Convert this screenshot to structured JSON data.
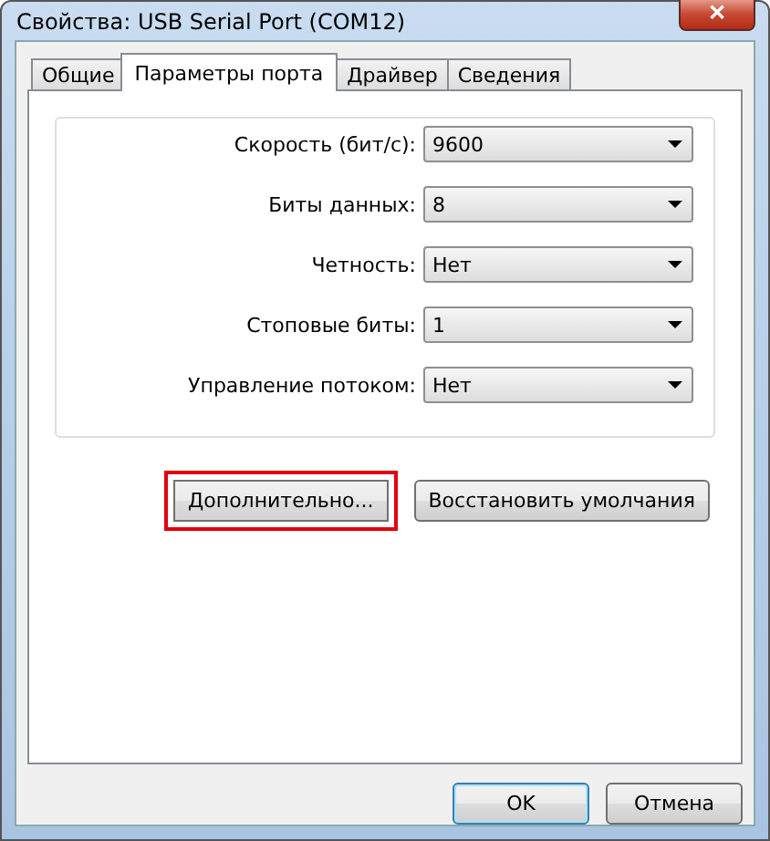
{
  "window": {
    "title": "Свойства: USB Serial Port (COM12)",
    "close": "✕"
  },
  "tabs": [
    {
      "label": "Общие",
      "selected": false
    },
    {
      "label": "Параметры порта",
      "selected": true
    },
    {
      "label": "Драйвер",
      "selected": false
    },
    {
      "label": "Сведения",
      "selected": false
    }
  ],
  "settings": [
    {
      "label": "Скорость (бит/с):",
      "value": "9600"
    },
    {
      "label": "Биты данных:",
      "value": "8"
    },
    {
      "label": "Четность:",
      "value": "Нет"
    },
    {
      "label": "Стоповые биты:",
      "value": "1"
    },
    {
      "label": "Управление потоком:",
      "value": "Нет"
    }
  ],
  "panel_buttons": [
    {
      "label": "Дополнительно...",
      "highlighted": true
    },
    {
      "label": "Восстановить умолчания",
      "highlighted": false
    }
  ],
  "dialog_buttons": [
    {
      "label": "OK",
      "default": true
    },
    {
      "label": "Отмена",
      "default": false
    }
  ]
}
